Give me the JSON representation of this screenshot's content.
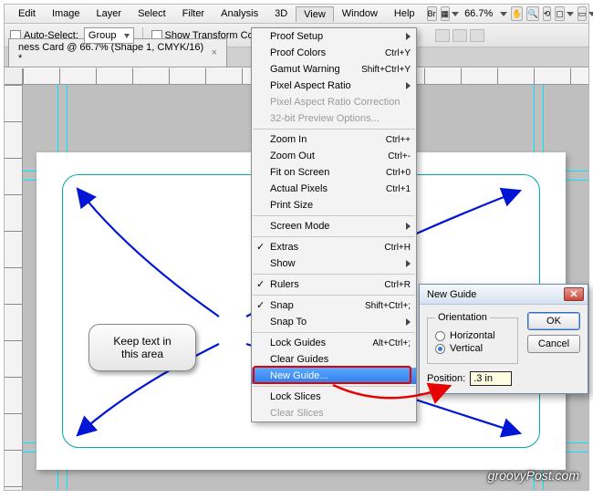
{
  "menubar": {
    "items": [
      "Edit",
      "Image",
      "Layer",
      "Select",
      "Filter",
      "Analysis",
      "3D",
      "View",
      "Window",
      "Help"
    ],
    "active": "View",
    "zoom": "66.7%"
  },
  "optbar": {
    "autoSelectLabel": "Auto-Select:",
    "autoSelectValue": "Group",
    "showTransform": "Show Transform Controls"
  },
  "tab": {
    "title": "ness Card @ 66.7% (Shape 1, CMYK/16) *"
  },
  "menu": {
    "items": [
      {
        "label": "Proof Setup",
        "sub": true
      },
      {
        "label": "Proof Colors",
        "shortcut": "Ctrl+Y"
      },
      {
        "label": "Gamut Warning",
        "shortcut": "Shift+Ctrl+Y"
      },
      {
        "label": "Pixel Aspect Ratio",
        "sub": true
      },
      {
        "label": "Pixel Aspect Ratio Correction",
        "disabled": true
      },
      {
        "label": "32-bit Preview Options...",
        "disabled": true
      },
      {
        "sep": true
      },
      {
        "label": "Zoom In",
        "shortcut": "Ctrl++"
      },
      {
        "label": "Zoom Out",
        "shortcut": "Ctrl+-"
      },
      {
        "label": "Fit on Screen",
        "shortcut": "Ctrl+0"
      },
      {
        "label": "Actual Pixels",
        "shortcut": "Ctrl+1"
      },
      {
        "label": "Print Size"
      },
      {
        "sep": true
      },
      {
        "label": "Screen Mode",
        "sub": true
      },
      {
        "sep": true
      },
      {
        "label": "Extras",
        "shortcut": "Ctrl+H",
        "check": true
      },
      {
        "label": "Show",
        "sub": true
      },
      {
        "sep": true
      },
      {
        "label": "Rulers",
        "shortcut": "Ctrl+R",
        "check": true
      },
      {
        "sep": true
      },
      {
        "label": "Snap",
        "shortcut": "Shift+Ctrl+;",
        "check": true
      },
      {
        "label": "Snap To",
        "sub": true
      },
      {
        "sep": true
      },
      {
        "label": "Lock Guides",
        "shortcut": "Alt+Ctrl+;"
      },
      {
        "label": "Clear Guides"
      },
      {
        "label": "New Guide...",
        "selected": true,
        "highlight": true
      },
      {
        "sep": true
      },
      {
        "label": "Lock Slices"
      },
      {
        "label": "Clear Slices",
        "disabled": true
      }
    ]
  },
  "dialog": {
    "title": "New Guide",
    "group": "Orientation",
    "optHorizontal": "Horizontal",
    "optVertical": "Vertical",
    "positionLabel": "Position:",
    "positionValue": ".3 in",
    "ok": "OK",
    "cancel": "Cancel"
  },
  "callout": {
    "line1": "Keep text in",
    "line2": "this area"
  },
  "watermark": "groovyPost.com"
}
